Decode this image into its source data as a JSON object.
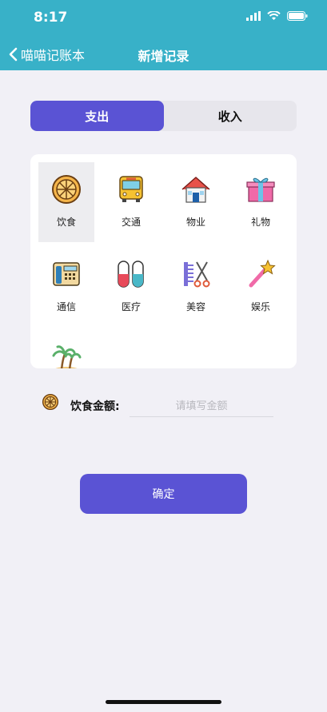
{
  "status": {
    "time": "8:17"
  },
  "nav": {
    "back_label": "喵喵记账本",
    "title": "新增记录"
  },
  "segment": {
    "expense": "支出",
    "income": "收入"
  },
  "categories": [
    {
      "label": "饮食",
      "icon": "orange-slice-icon",
      "selected": true
    },
    {
      "label": "交通",
      "icon": "bus-icon"
    },
    {
      "label": "物业",
      "icon": "house-icon"
    },
    {
      "label": "礼物",
      "icon": "gift-icon"
    },
    {
      "label": "通信",
      "icon": "telephone-icon"
    },
    {
      "label": "医疗",
      "icon": "pill-capsule-icon"
    },
    {
      "label": "美容",
      "icon": "comb-scissors-icon"
    },
    {
      "label": "娱乐",
      "icon": "magic-wand-icon"
    },
    {
      "label": "",
      "icon": "palm-island-icon"
    }
  ],
  "amount": {
    "label": "饮食金额:",
    "placeholder": "请填写金额",
    "value": ""
  },
  "confirm_label": "确定",
  "colors": {
    "header": "#38b1c8",
    "accent": "#5a53d4",
    "background": "#f1f0f6"
  }
}
